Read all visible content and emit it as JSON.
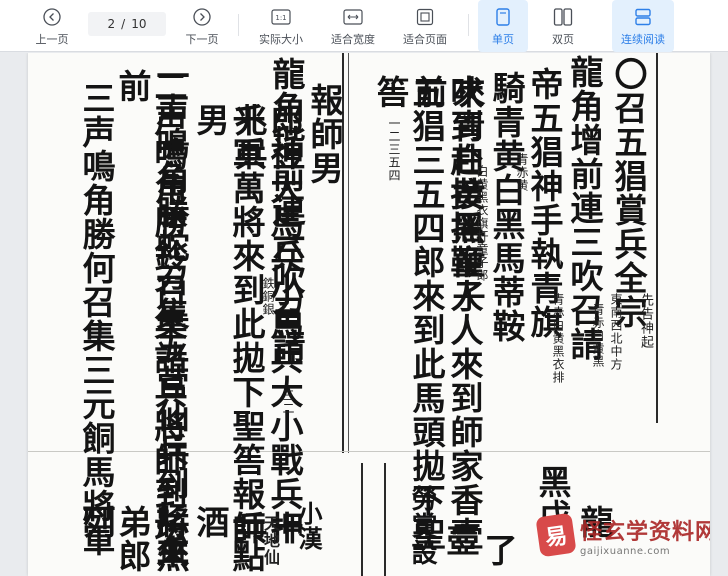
{
  "toolbar": {
    "prev_label": "上一页",
    "next_label": "下一页",
    "current_page": "2",
    "separator": "/",
    "total_pages": "10",
    "actual_size_label": "实际大小",
    "actual_size_badge": "1:1",
    "fit_width_label": "适合宽度",
    "fit_page_label": "适合页面",
    "single_page_label": "单页",
    "double_page_label": "双页",
    "continuous_label": "连续阅读",
    "accent": "#2d7fe8"
  },
  "document": {
    "right_page": {
      "columns": [
        "〇召五猖賞兵全宗",
        "龍角增前連三吹召請",
        "帝五猖神手執青旗",
        "騎青黄白黑馬蒂鞍",
        "來青白黄黑童子",
        "吠到赴接摇鞭人人來到師家香壹前",
        "五猖三五四郎來到此馬頭拋下聖筶"
      ],
      "note": "先告神起",
      "small_notes": [
        "東南西北中方",
        "青赤白黄黑",
        "青赤白黄黑衣排",
        "青赤黄",
        "白黄黑衣旗杆童子郎",
        "一二三五四"
      ]
    },
    "left_page": {
      "columns": [
        "報師男",
        "龍角堦前連六吹召請",
        "郎神大馬兵小馬兵大小戰兵十兆兵",
        "千軍萬將來到此拋下聖筶報師男",
        "一声鳴角勝蛇召集五营仙兵到坛來",
        "二声鳴角勝鈴召集諸兵將師到坛前",
        "三声鳴角勝何召集三元餇馬將軍"
      ],
      "small_notes": [
        "鉄銅銀",
        "三二",
        "大",
        "小",
        "兆"
      ]
    },
    "lower_fragments": [
      "列",
      "弟郎",
      "將無",
      "一點酒",
      "押兵",
      "天地仙",
      "小漢",
      "勞賞設",
      "壺",
      "了",
      "黑戊",
      "龍"
    ]
  },
  "watermark": {
    "logo_text": "易",
    "name": "怪玄学资料网",
    "url": "gaijixuanne.com"
  }
}
